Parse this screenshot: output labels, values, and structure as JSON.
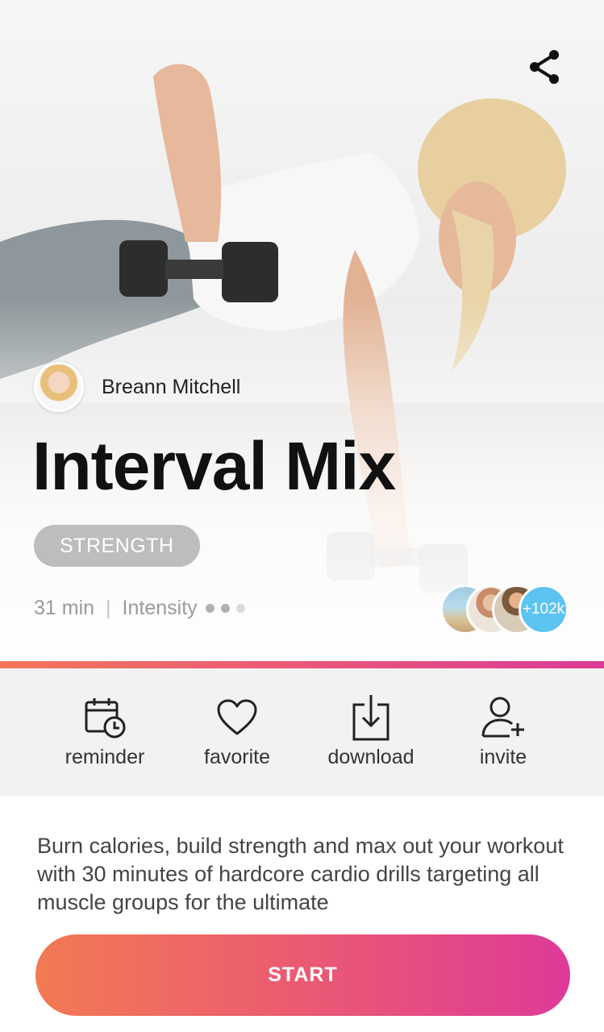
{
  "hero": {
    "trainer_name": "Breann Mitchell",
    "workout_title": "Interval Mix",
    "category_tag": "STRENGTH",
    "duration": "31 min",
    "intensity_label": "Intensity",
    "intensity_level": 2,
    "intensity_max": 3,
    "participant_count": "+102k",
    "share_icon": "share-icon"
  },
  "actions": [
    {
      "label": "reminder",
      "icon": "calendar-clock-icon"
    },
    {
      "label": "favorite",
      "icon": "heart-icon"
    },
    {
      "label": "download",
      "icon": "download-icon"
    },
    {
      "label": "invite",
      "icon": "add-user-icon"
    }
  ],
  "description": "Burn calories, build strength and max out your workout with 30 minutes of hardcore cardio drills targeting all muscle groups for the ultimate",
  "start_button": "START",
  "colors": {
    "accent_start": "#f27a53",
    "accent_end": "#de3a98",
    "participant_badge": "#5bc4f0"
  }
}
